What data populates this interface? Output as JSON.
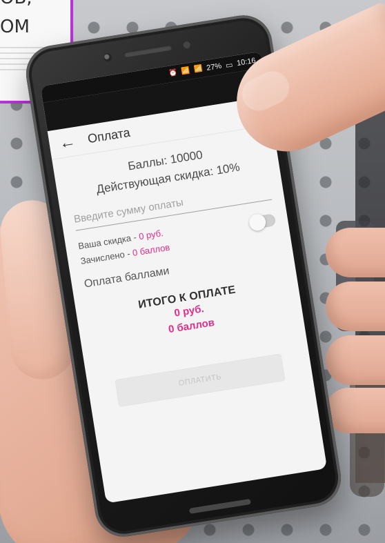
{
  "promo": {
    "text": "ОВ,\nОМ"
  },
  "status_bar": {
    "icons": [
      "⏰",
      "📶",
      "📶"
    ],
    "battery": "27%",
    "time": "10:16"
  },
  "top_bar": {
    "menu_icon": "⋮"
  },
  "app_bar": {
    "back_icon": "←",
    "title": "Оплата"
  },
  "main": {
    "points": "Баллы: 10000",
    "active_discount": "Действующая скидка: 10%",
    "payment_input": {
      "placeholder": "Введите сумму оплаты",
      "value": ""
    },
    "discount_label": "Ваша скидка - ",
    "discount_value": "0 руб.",
    "credited_label": "Зачислено - ",
    "credited_value": "0 баллов",
    "pay_with_points_label": "Оплата баллами",
    "pay_with_points_enabled": false,
    "total_title": "ИТОГО К ОПЛАТЕ",
    "total_rub": "0 руб.",
    "total_points": "0 баллов",
    "pay_button": "ОПЛАТИТЬ"
  },
  "colors": {
    "accent": "#e12d8b",
    "promo_border": "#b833d8"
  }
}
